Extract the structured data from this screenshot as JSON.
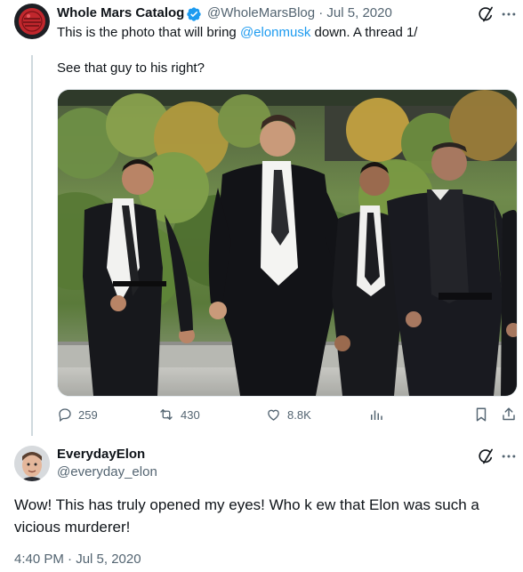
{
  "tweet1": {
    "display_name": "Whole Mars Catalog",
    "handle_date": "@WholeMarsBlog · Jul 5, 2020",
    "line1_prefix": "This is the photo that will bring ",
    "line1_mention": "@elonmusk",
    "line1_suffix": " down. A thread 1/",
    "line2": "See that guy to his right?",
    "stats": {
      "replies": "259",
      "retweets": "430",
      "likes": "8.8K"
    }
  },
  "tweet2": {
    "display_name": "EverydayElon",
    "handle": "@everyday_elon",
    "text": "Wow! This has truly opened my eyes! Who k ew that Elon was such a vicious murderer!",
    "timestamp": "4:40 PM · Jul 5, 2020"
  },
  "colors": {
    "accent": "#1d9bf0",
    "muted": "#536471",
    "verified": "#1d9bf0",
    "avatar1": "#c1272d"
  },
  "icons": [
    "grok-icon",
    "more-icon",
    "verified-badge-icon",
    "reply-icon",
    "retweet-icon",
    "like-icon",
    "analytics-icon",
    "bookmark-icon",
    "share-icon"
  ]
}
